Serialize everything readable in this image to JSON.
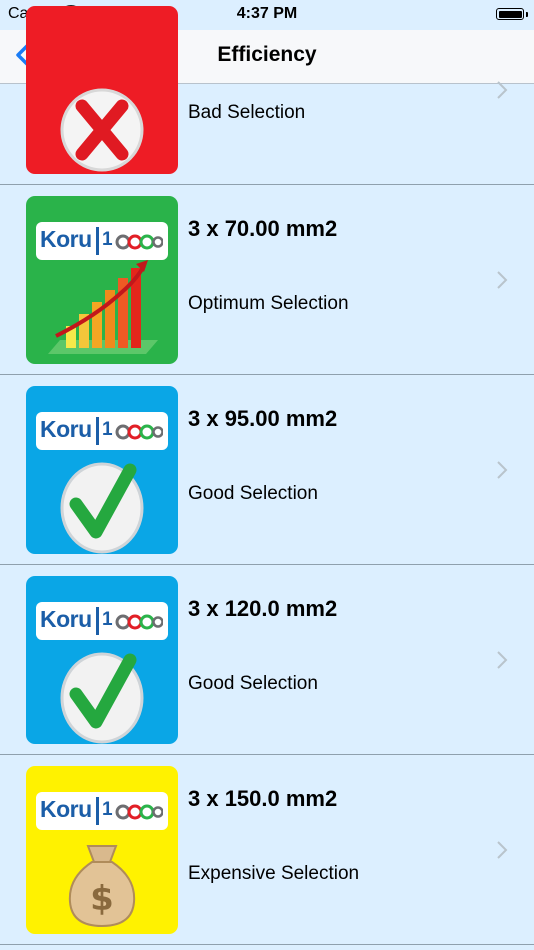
{
  "status_bar": {
    "carrier": "Carrier",
    "time": "4:37 PM"
  },
  "nav": {
    "title": "Efficiency"
  },
  "rows": [
    {
      "size": "",
      "status": "Bad Selection",
      "thumb": "bad-selection-x-icon"
    },
    {
      "size": "3 x 70.00 mm2",
      "status": "Optimum Selection",
      "thumb": "bar-chart-icon"
    },
    {
      "size": "3 x 95.00 mm2",
      "status": "Good Selection",
      "thumb": "checkmark-icon"
    },
    {
      "size": "3 x 120.0 mm2",
      "status": "Good Selection",
      "thumb": "checkmark-icon"
    },
    {
      "size": "3 x 150.0 mm2",
      "status": "Expensive Selection",
      "thumb": "money-bag-icon"
    }
  ],
  "logo": {
    "koru": "Koru",
    "number_prefix": "1"
  },
  "colors": {
    "background": "#dcefff",
    "accent_blue": "#1a7cf5",
    "optimum_green": "#2ab34a",
    "good_blue": "#0aa6e6",
    "expensive_yellow": "#fff200",
    "bad_red": "#ee1c25"
  }
}
